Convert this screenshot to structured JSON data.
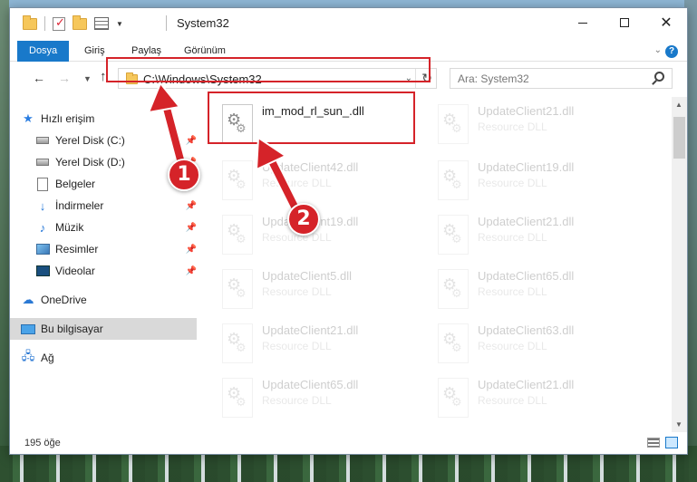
{
  "titlebar": {
    "title": "System32"
  },
  "ribbon": {
    "tabs": [
      {
        "label": "Dosya"
      },
      {
        "label": "Giriş"
      },
      {
        "label": "Paylaş"
      },
      {
        "label": "Görünüm"
      }
    ]
  },
  "address": {
    "path": "C:\\Windows\\System32"
  },
  "search": {
    "placeholder": "Ara: System32"
  },
  "sidebar": {
    "items": [
      {
        "label": "Hızlı erişim",
        "icon": "star-icon"
      },
      {
        "label": "Yerel Disk (C:)",
        "icon": "drive-icon"
      },
      {
        "label": "Yerel Disk (D:)",
        "icon": "drive-icon"
      },
      {
        "label": "Belgeler",
        "icon": "documents-icon"
      },
      {
        "label": "İndirmeler",
        "icon": "download-icon"
      },
      {
        "label": "Müzik",
        "icon": "music-icon"
      },
      {
        "label": "Resimler",
        "icon": "pictures-icon"
      },
      {
        "label": "Videolar",
        "icon": "videos-icon"
      },
      {
        "label": "OneDrive",
        "icon": "cloud-icon"
      },
      {
        "label": "Bu bilgisayar",
        "icon": "computer-icon"
      },
      {
        "label": "Ağ",
        "icon": "network-icon"
      }
    ]
  },
  "files": [
    {
      "name": "im_mod_rl_sun_.dll",
      "desc": ""
    },
    {
      "name": "UpdateClient21.dll",
      "desc": "Resource DLL"
    },
    {
      "name": "UpdateClient42.dll",
      "desc": "Resource DLL"
    },
    {
      "name": "UpdateClient19.dll",
      "desc": "Resource DLL"
    },
    {
      "name": "UpdateClient19.dll",
      "desc": "Resource DLL"
    },
    {
      "name": "UpdateClient21.dll",
      "desc": "Resource DLL"
    },
    {
      "name": "UpdateClient5.dll",
      "desc": "Resource DLL"
    },
    {
      "name": "UpdateClient65.dll",
      "desc": "Resource DLL"
    },
    {
      "name": "UpdateClient21.dll",
      "desc": "Resource DLL"
    },
    {
      "name": "UpdateClient63.dll",
      "desc": "Resource DLL"
    },
    {
      "name": "UpdateClient65.dll",
      "desc": "Resource DLL"
    },
    {
      "name": "UpdateClient21.dll",
      "desc": "Resource DLL"
    }
  ],
  "status": {
    "count": "195 öğe"
  },
  "callouts": {
    "one": "1",
    "two": "2"
  },
  "colors": {
    "accent": "#1979ca",
    "highlight": "#d52329"
  }
}
